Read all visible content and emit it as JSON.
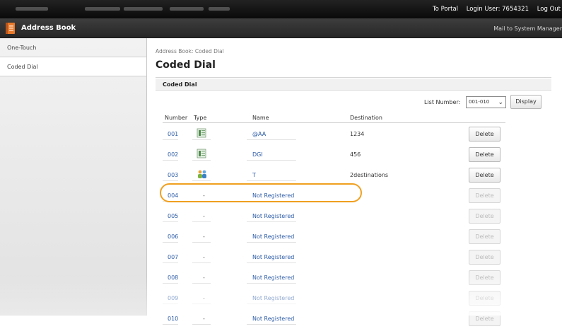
{
  "top_bar": {
    "to_portal": "To Portal",
    "login_user": "Login User: 7654321",
    "logout": "Log Out"
  },
  "title_bar": {
    "app_title": "Address Book",
    "mail_link": "Mail to System Manager"
  },
  "sidebar": {
    "items": [
      {
        "label": "One-Touch",
        "active": false
      },
      {
        "label": "Coded Dial",
        "active": true
      }
    ]
  },
  "main": {
    "breadcrumb": "Address Book: Coded Dial",
    "page_title": "Coded Dial",
    "section_title": "Coded Dial",
    "list_number_label": "List Number:",
    "list_number_value": "001-010",
    "display_button": "Display",
    "columns": {
      "number": "Number",
      "type": "Type",
      "name": "Name",
      "destination": "Destination"
    },
    "rows": [
      {
        "number": "001",
        "type": "fax-icon",
        "name": "@AA",
        "destination": "1234",
        "delete": "Delete",
        "delete_enabled": true
      },
      {
        "number": "002",
        "type": "fax-icon",
        "name": "DGI",
        "destination": "456",
        "delete": "Delete",
        "delete_enabled": true
      },
      {
        "number": "003",
        "type": "group-icon",
        "name": "T",
        "destination": "2destinations",
        "delete": "Delete",
        "delete_enabled": true
      },
      {
        "number": "004",
        "type": "-",
        "name": "Not Registered",
        "destination": "",
        "delete": "Delete",
        "delete_enabled": false
      },
      {
        "number": "005",
        "type": "-",
        "name": "Not Registered",
        "destination": "",
        "delete": "Delete",
        "delete_enabled": false
      },
      {
        "number": "006",
        "type": "-",
        "name": "Not Registered",
        "destination": "",
        "delete": "Delete",
        "delete_enabled": false
      },
      {
        "number": "007",
        "type": "-",
        "name": "Not Registered",
        "destination": "",
        "delete": "Delete",
        "delete_enabled": false
      },
      {
        "number": "008",
        "type": "-",
        "name": "Not Registered",
        "destination": "",
        "delete": "Delete",
        "delete_enabled": false
      },
      {
        "number": "009",
        "type": "-",
        "name": "Not Registered",
        "destination": "",
        "delete": "Delete",
        "delete_enabled": false
      },
      {
        "number": "010",
        "type": "-",
        "name": "Not Registered",
        "destination": "",
        "delete": "Delete",
        "delete_enabled": false
      }
    ]
  },
  "colors": {
    "link_blue": "#2b5aa6",
    "highlight_orange": "#f0a020",
    "bar_dark": "#111111"
  }
}
